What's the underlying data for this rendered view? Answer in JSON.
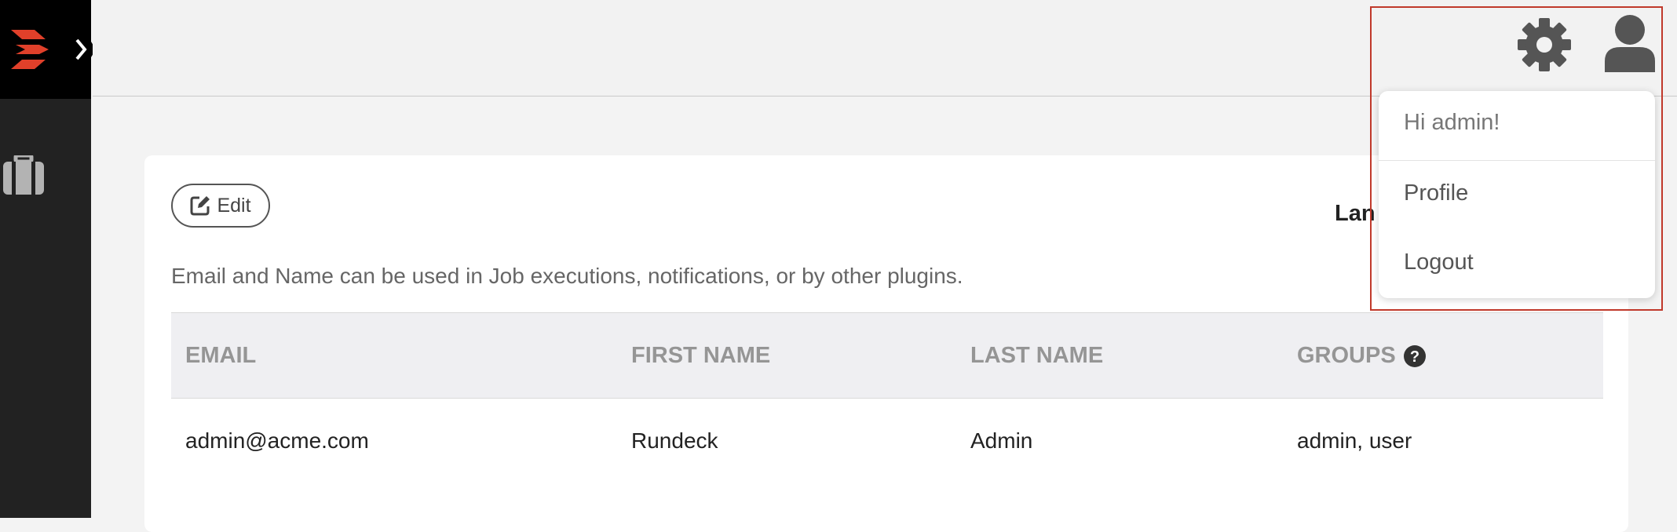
{
  "header": {
    "settings_icon": "gear-icon",
    "user_icon": "user-icon"
  },
  "sidebar": {
    "logo": "rundeck-logo-icon",
    "expand_icon": "chevron-right-icon",
    "projects_icon": "briefcase-icon"
  },
  "user_menu": {
    "greeting": "Hi admin!",
    "items": [
      {
        "label": "Profile"
      },
      {
        "label": "Logout"
      }
    ]
  },
  "profile": {
    "edit_label": "Edit",
    "lang_heading": "Lan",
    "description": "Email and Name can be used in Job executions, notifications, or by other plugins.",
    "table": {
      "headers": [
        "EMAIL",
        "FIRST NAME",
        "LAST NAME",
        "GROUPS"
      ],
      "rows": [
        [
          "admin@acme.com",
          "Rundeck",
          "Admin",
          "admin, user"
        ]
      ]
    }
  },
  "colors": {
    "sidebar_bg": "#222222",
    "brand_red": "#e0402a",
    "highlight": "#c0392b"
  }
}
